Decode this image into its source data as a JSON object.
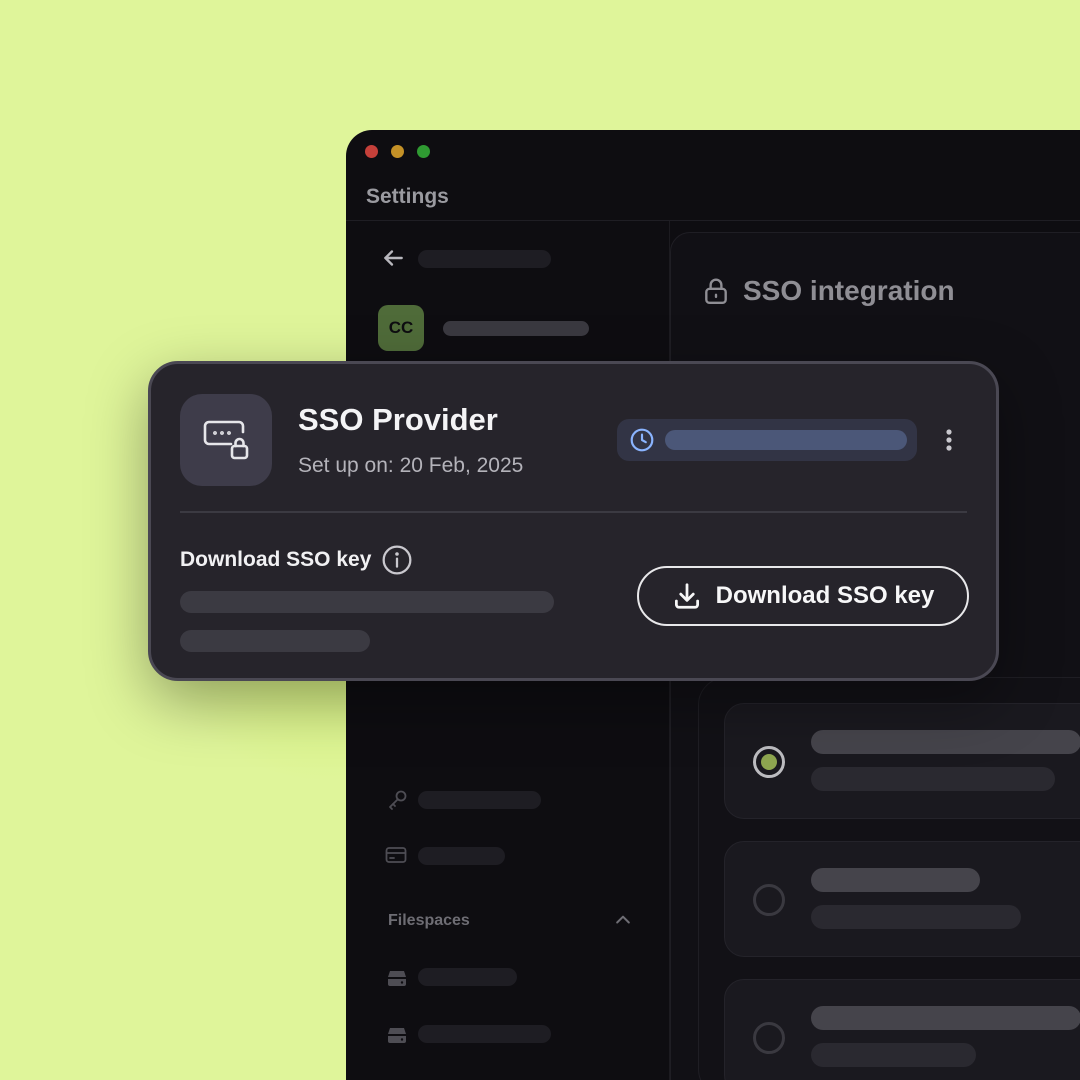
{
  "window": {
    "title": "Settings",
    "traffic_lights": [
      "#e0443e",
      "#dea123",
      "#1aab29"
    ]
  },
  "sidebar": {
    "avatar_initials": "CC",
    "section_label": "Filespaces",
    "icons": [
      "back-arrow-icon",
      "key-icon",
      "credit-card-icon",
      "drive-icon",
      "drive-icon",
      "chevron-up-icon"
    ]
  },
  "main": {
    "title": "SSO integration",
    "title_icon": "lock-icon",
    "options": [
      {
        "selected": true
      },
      {
        "selected": false
      },
      {
        "selected": false
      }
    ]
  },
  "sso_card": {
    "provider_name": "SSO Provider",
    "setup_date": "Set up on: 20 Feb, 2025",
    "status_icon": "clock-icon",
    "download_label": "Download SSO key",
    "download_button": "Download SSO key",
    "colors": {
      "status_accent": "#8ab4ff",
      "radio_accent": "#8ea650"
    }
  }
}
